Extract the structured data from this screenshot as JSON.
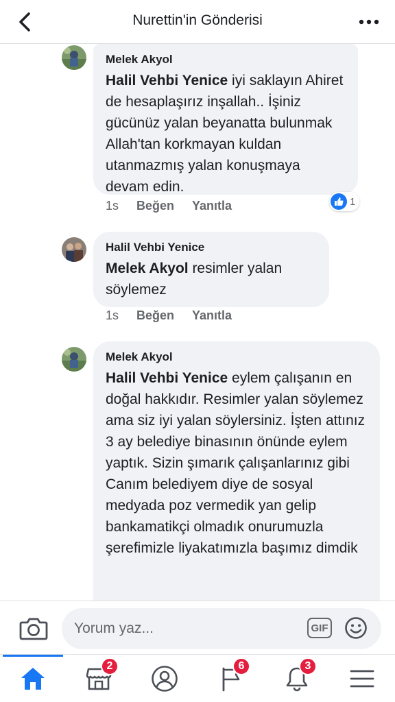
{
  "header": {
    "title": "Nurettin'in Gönderisi",
    "back_icon": "chevron-left-icon",
    "more_icon": "more-horizontal-icon"
  },
  "comments": [
    {
      "author": "Melek Akyol",
      "mention": "Halil Vehbi Yenice",
      "text": " iyi saklayın Ahiret de  hesaplaşırız inşallah.. İşiniz gücünüz yalan beyanatta bulunmak Allah'tan korkmayan kuldan utanmazmış yalan konuşmaya devam edin.",
      "time": "1s",
      "like_label": "Beğen",
      "reply_label": "Yanıtla",
      "reaction_count": "1"
    },
    {
      "author": "Halil Vehbi Yenice",
      "mention": "Melek Akyol",
      "text": "  resimler yalan söylemez",
      "time": "1s",
      "like_label": "Beğen",
      "reply_label": "Yanıtla"
    },
    {
      "author": "Melek Akyol",
      "mention": "Halil Vehbi Yenice",
      "text": " eylem çalışanın en doğal hakkıdır. Resimler yalan söylemez ama siz iyi yalan söylersiniz. İşten attınız 3 ay belediye binasının önünde eylem yaptık. Sizin şımarık çalışanlarınız gibi Canım belediyem diye de sosyal medyada poz vermedik yan gelip bankamatikçi olmadık onurumuzla şerefimizle liyakatımızla başımız dimdik"
    }
  ],
  "composer": {
    "placeholder": "Yorum yaz...",
    "gif_label": "GIF",
    "camera_icon": "camera-icon",
    "emoji_icon": "smiley-icon"
  },
  "tabbar": {
    "items": [
      {
        "name": "home",
        "icon": "home-icon",
        "active": true
      },
      {
        "name": "marketplace",
        "icon": "store-icon",
        "badge": "2"
      },
      {
        "name": "profile",
        "icon": "profile-icon"
      },
      {
        "name": "pages",
        "icon": "flag-icon",
        "badge": "6"
      },
      {
        "name": "notifications",
        "icon": "bell-icon",
        "badge": "3"
      },
      {
        "name": "menu",
        "icon": "menu-icon"
      }
    ]
  },
  "colors": {
    "accent": "#1877f2",
    "badge": "#e41e3f",
    "bubble": "#f0f2f5",
    "secondary_text": "#65676b"
  }
}
